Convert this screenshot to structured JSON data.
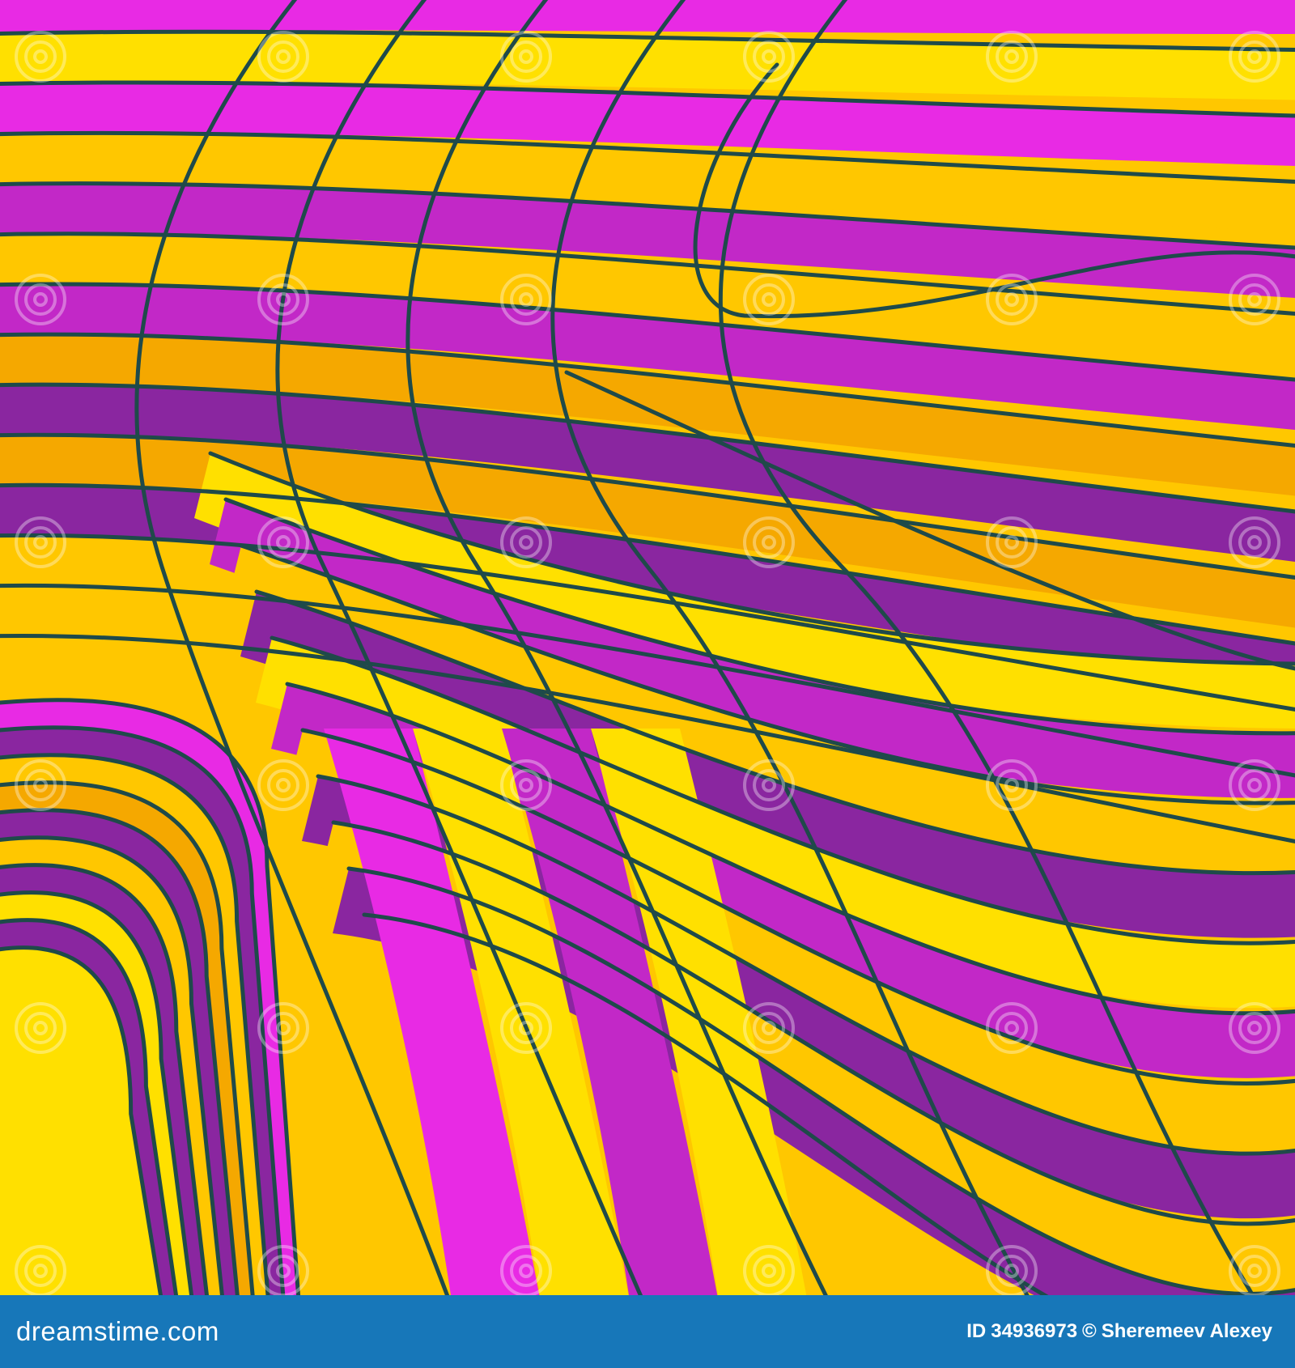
{
  "image": {
    "colors": {
      "magenta": "#e82ae4",
      "purple": "#c228c7",
      "deep_purple": "#8a26a0",
      "yellow": "#ffe000",
      "gold": "#ffc700",
      "orange": "#f5a800",
      "outline": "#1f4a4a",
      "footer_bg": "#1777b9"
    },
    "watermark_text": "dreamstime"
  },
  "footer": {
    "site": "dreamstime.com",
    "id_label": "ID",
    "id_number": "34936973",
    "copyright": "©",
    "author": "Sheremeev Alexey"
  }
}
